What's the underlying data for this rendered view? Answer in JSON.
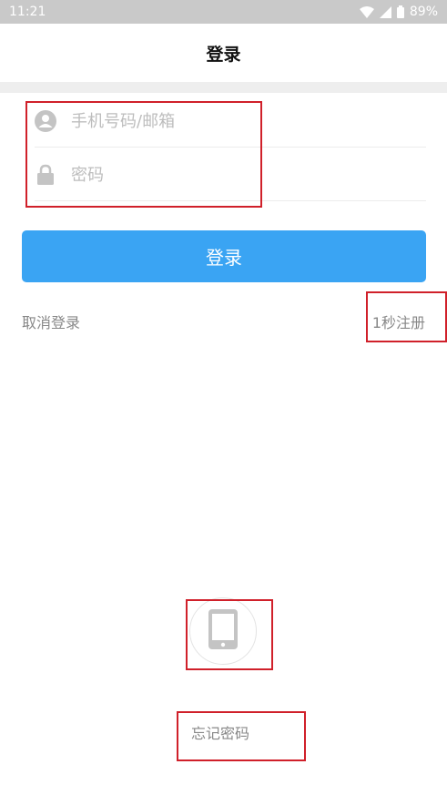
{
  "status_bar": {
    "time": "11:21",
    "battery": "89%"
  },
  "header": {
    "title": "登录"
  },
  "form": {
    "username_placeholder": "手机号码/邮箱",
    "password_placeholder": "密码",
    "login_label": "登录"
  },
  "links": {
    "cancel_login": "取消登录",
    "register": "1秒注册",
    "forgot_password": "忘记密码"
  },
  "icons": {
    "username": "user-icon",
    "password": "lock-icon",
    "alt_login": "phone-icon"
  },
  "colors": {
    "primary_button": "#3aa4f3",
    "annotation_box": "#d0202a",
    "placeholder": "#bdbdbd",
    "link_text": "#888888"
  }
}
